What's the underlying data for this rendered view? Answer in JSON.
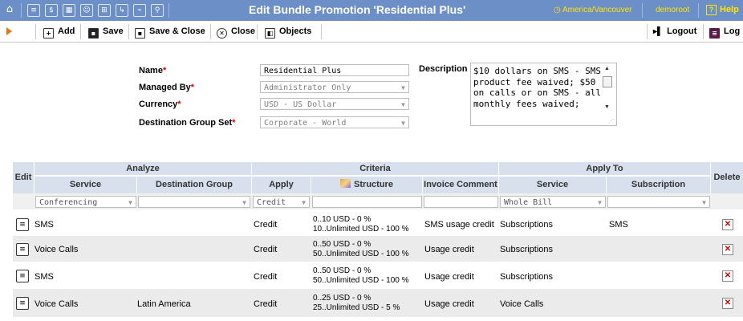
{
  "header": {
    "title": "Edit Bundle Promotion 'Residential Plus'",
    "timezone": "America/Vancouver",
    "user": "demoroot",
    "help": "Help"
  },
  "toolbar": {
    "add": "Add",
    "save": "Save",
    "save_close": "Save & Close",
    "close": "Close",
    "objects": "Objects",
    "logout": "Logout",
    "log": "Log"
  },
  "form": {
    "name_label": "Name",
    "name_value": "Residential Plus",
    "managed_label": "Managed By",
    "managed_value": "Administrator Only",
    "currency_label": "Currency",
    "currency_value": "USD - US Dollar",
    "dgs_label": "Destination Group Set",
    "dgs_value": "Corporate - World",
    "desc_label": "Description",
    "desc_value": "$10 dollars on SMS - SMS product fee waived; $50 on calls or on SMS - all monthly fees waived;"
  },
  "table": {
    "group_headers": {
      "analyze": "Analyze",
      "criteria": "Criteria",
      "apply_to": "Apply To"
    },
    "columns": {
      "edit": "Edit",
      "service": "Service",
      "dest_group": "Destination Group",
      "apply": "Apply",
      "structure": "Structure",
      "invoice_comment": "Invoice Comment",
      "apply_service": "Service",
      "subscription": "Subscription",
      "delete": "Delete"
    },
    "filters": {
      "service": "Conferencing",
      "apply": "Credit",
      "apply_service": "Whole Bill"
    },
    "rows": [
      {
        "service": "SMS",
        "dest_group": "",
        "apply": "Credit",
        "structure_1": "0..10 USD - 0 %",
        "structure_2": "10..Unlimited USD - 100 %",
        "invoice_comment": "SMS usage credit",
        "apply_service": "Subscriptions",
        "subscription": "SMS"
      },
      {
        "service": "Voice Calls",
        "dest_group": "",
        "apply": "Credit",
        "structure_1": "0..50 USD - 0 %",
        "structure_2": "50..Unlimited USD - 100 %",
        "invoice_comment": "Usage credit",
        "apply_service": "Subscriptions",
        "subscription": ""
      },
      {
        "service": "SMS",
        "dest_group": "",
        "apply": "Credit",
        "structure_1": "0..50 USD - 0 %",
        "structure_2": "50..Unlimited USD - 100 %",
        "invoice_comment": "Usage credit",
        "apply_service": "Subscriptions",
        "subscription": ""
      },
      {
        "service": "Voice Calls",
        "dest_group": "Latin America",
        "apply": "Credit",
        "structure_1": "0..25 USD - 0 %",
        "structure_2": "25..Unlimited USD - 5 %",
        "invoice_comment": "Usage credit",
        "apply_service": "Voice Calls",
        "subscription": ""
      }
    ]
  },
  "colors": {
    "topbar": "#6c8fc8",
    "header_cell": "#d7e0ec",
    "alt_row": "#ebebeb",
    "accent_text": "#ffe400"
  }
}
